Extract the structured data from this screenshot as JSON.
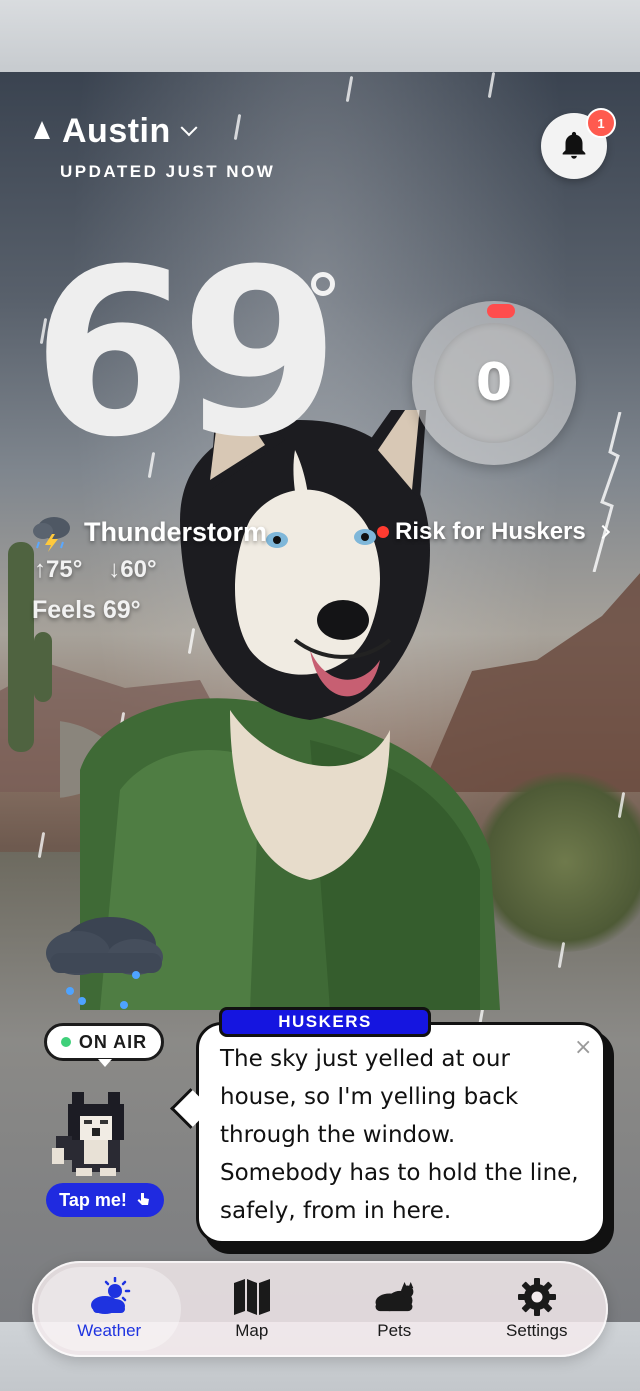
{
  "header": {
    "city": "Austin",
    "updated": "UPDATED JUST NOW",
    "notification_count": "1"
  },
  "weather": {
    "temperature": "69",
    "condition": "Thunderstorm",
    "high": "75°",
    "low": "60°",
    "feels_like": "Feels 69°"
  },
  "risk": {
    "score": "0",
    "label": "Risk for Huskers"
  },
  "companion": {
    "on_air": "ON AIR",
    "tap_label": "Tap me!",
    "speaker": "HUSKERS",
    "message": "The sky just yelled at our house, so I'm yelling back through the window. Somebody has to hold the line, safely, from in here.",
    "close": "×"
  },
  "tabs": [
    {
      "label": "Weather",
      "icon": "cloud-sun-icon",
      "active": true
    },
    {
      "label": "Map",
      "icon": "map-icon",
      "active": false
    },
    {
      "label": "Pets",
      "icon": "cloud-cat-icon",
      "active": false
    },
    {
      "label": "Settings",
      "icon": "gear-icon",
      "active": false
    }
  ],
  "colors": {
    "accent": "#1E33E0",
    "badge": "#FF5A4F",
    "risk_indicator": "#FF4D4D"
  }
}
